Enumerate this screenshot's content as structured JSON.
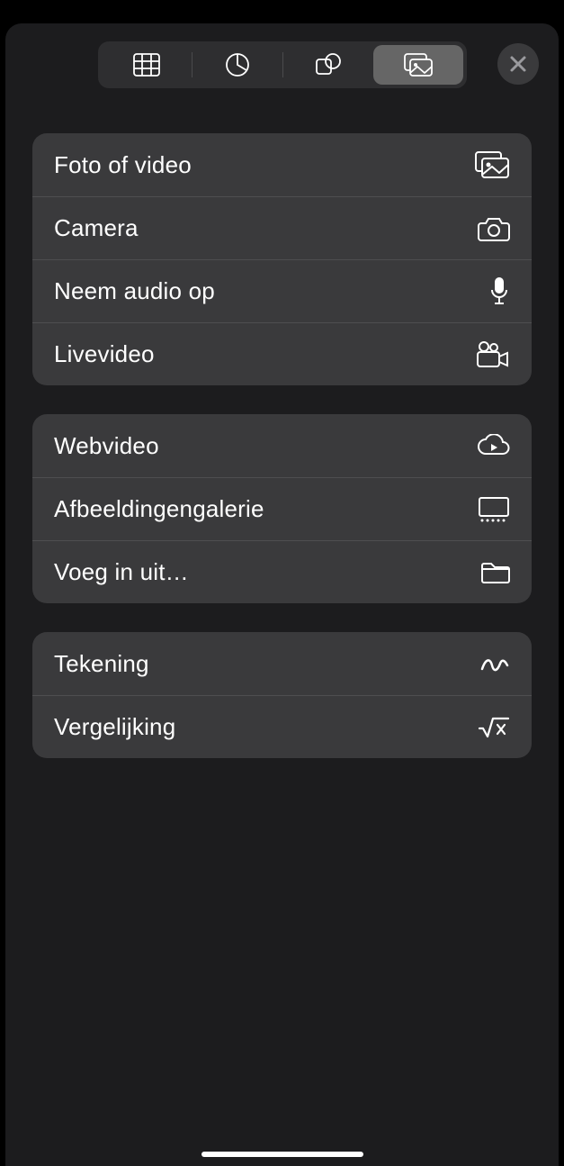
{
  "groups": [
    {
      "items": [
        {
          "label": "Foto of video",
          "icon": "photo"
        },
        {
          "label": "Camera",
          "icon": "camera"
        },
        {
          "label": "Neem audio op",
          "icon": "mic"
        },
        {
          "label": "Livevideo",
          "icon": "videocam"
        }
      ]
    },
    {
      "items": [
        {
          "label": "Webvideo",
          "icon": "cloud-play"
        },
        {
          "label": "Afbeeldingengalerie",
          "icon": "gallery"
        },
        {
          "label": "Voeg in uit…",
          "icon": "folder"
        }
      ]
    },
    {
      "items": [
        {
          "label": "Tekening",
          "icon": "scribble"
        },
        {
          "label": "Vergelijking",
          "icon": "sqrt"
        }
      ]
    }
  ],
  "tabs": [
    "table",
    "chart",
    "shapes",
    "media"
  ],
  "activeTab": "media"
}
